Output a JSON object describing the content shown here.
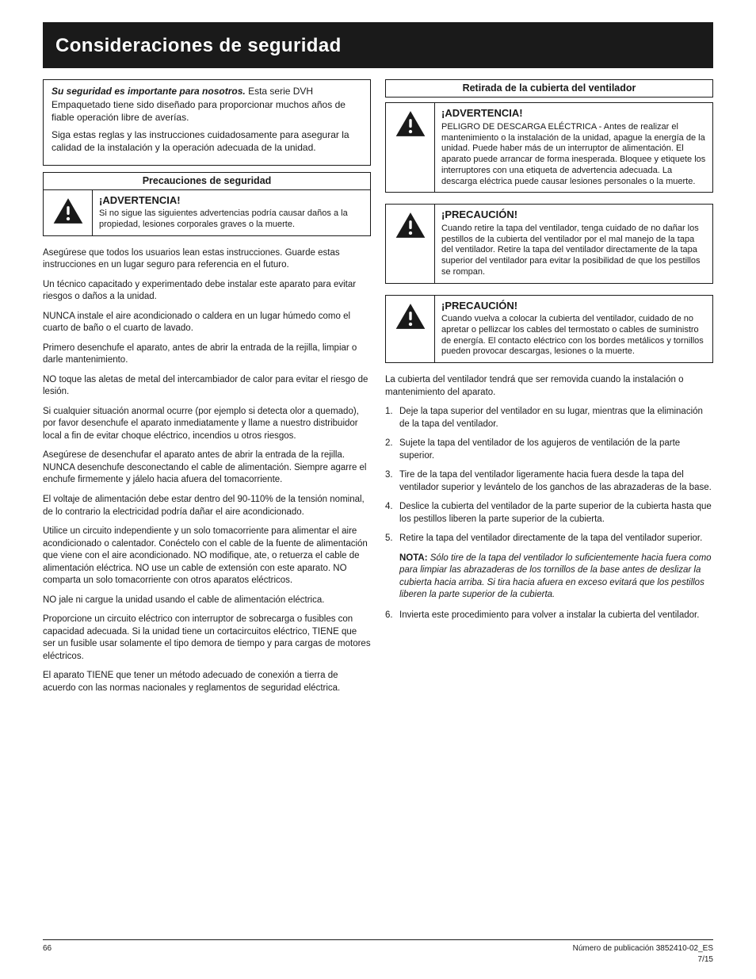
{
  "header": {
    "title": "Consideraciones de seguridad"
  },
  "left": {
    "intro": {
      "p1_prefix": "Su seguridad es importante para nosotros.",
      "p1_rest": " Esta serie DVH Empaquetado tiene sido diseñado para proporcionar muchos años de fiable operación libre de averías.",
      "p2": "Siga estas reglas y las instrucciones cuidadosamente para asegurar la calidad de la instalación y la operación adecuada de la unidad."
    },
    "section_title": "Precauciones de seguridad",
    "warn": {
      "title": "¡ADVERTENCIA!",
      "body": "Si no sigue las siguientes advertencias podría causar daños a la propiedad, lesiones corporales graves o la muerte."
    },
    "body": {
      "p1": "Asegúrese que todos los usuarios lean estas instrucciones. Guarde estas instrucciones en un lugar seguro para referencia en el futuro.",
      "p2": "Un técnico capacitado y experimentado debe instalar este aparato para evitar riesgos o daños a la unidad.",
      "p3": "NUNCA instale el aire acondicionado o caldera en un lugar húmedo como el cuarto de baño o el cuarto de lavado.",
      "p4": "Primero desenchufe el aparato, antes de abrir la entrada de la rejilla, limpiar o darle mantenimiento.",
      "p5": "NO toque las aletas de metal del intercambiador de calor para evitar el riesgo de lesión.",
      "p6": "Si cualquier situación anormal ocurre (por ejemplo si detecta olor a quemado), por favor desenchufe el aparato inmediatamente y llame a nuestro distribuidor local a fin de evitar choque eléctrico, incendios u otros riesgos.",
      "p7": "Asegúrese de desenchufar el aparato antes de abrir la entrada de la rejilla. NUNCA desenchufe desconectando el cable de alimentación. Siempre agarre el enchufe firmemente y jálelo hacia afuera del tomacorriente.",
      "p8": "El voltaje de alimentación debe estar dentro del 90-110% de la tensión nominal, de lo contrario la electricidad podría dañar el aire acondicionado.",
      "p9": "Utilice un circuito independiente y un solo tomacorriente para alimentar el aire acondicionado o calentador. Conéctelo con el cable de la fuente de alimentación que viene con el aire acondicionado. NO modifique, ate, o retuerza el cable de alimentación eléctrica. NO use un cable de extensión con este aparato. NO comparta un solo tomacorriente con otros aparatos eléctricos.",
      "p10": "NO jale ni cargue la unidad usando el cable de alimentación eléctrica.",
      "p11": "Proporcione un circuito eléctrico con interruptor de sobrecarga o fusibles con capacidad adecuada. Si la unidad tiene un cortacircuitos eléctrico, TIENE que ser un fusible usar solamente el tipo demora de tiempo y para cargas de motores eléctricos.",
      "p12": "El aparato TIENE que tener un método adecuado de conexión a tierra de acuerdo con las normas nacionales y reglamentos de seguridad eléctrica."
    }
  },
  "right": {
    "section_title": "Retirada de la cubierta del ventilador",
    "w1": {
      "title": "¡ADVERTENCIA!",
      "body": "PELIGRO DE DESCARGA ELÉCTRICA - Antes de realizar el mantenimiento o la instalación de la unidad, apague la energía de la unidad. Puede haber más de un interruptor de alimentación. El aparato puede arrancar de forma inesperada. Bloquee y etiquete los interruptores con una etiqueta de advertencia adecuada. La descarga eléctrica puede causar lesiones personales o la muerte."
    },
    "w2": {
      "title": "¡PRECAUCIÓN!",
      "body": "Cuando retire la tapa del ventilador, tenga cuidado de no dañar los pestillos de la cubierta del ventilador por el mal manejo de la tapa del ventilador. Retire la tapa del ventilador directamente de la tapa superior del ventilador para evitar la posibilidad de que los pestillos se rompan."
    },
    "w3": {
      "title": "¡PRECAUCIÓN!",
      "body": "Cuando vuelva a colocar la cubierta del ventilador, cuidado de no apretar o pellizcar los cables del termostato o cables de suministro de energía. El contacto eléctrico con los bordes metálicos y tornillos pueden provocar descargas, lesiones o la muerte."
    },
    "body": {
      "p_intro": "La cubierta del ventilador tendrá que ser removida cuando la instalación o mantenimiento del aparato.",
      "n1": {
        "num": "1.",
        "text": "Deje la tapa superior del ventilador en su lugar, mientras que la eliminación de la tapa del ventilador."
      },
      "n2": {
        "num": "2.",
        "text": "Sujete la tapa del ventilador de los agujeros de ventilación de la parte superior."
      },
      "n3": {
        "num": "3.",
        "text": "Tire de la tapa del ventilador ligeramente hacia fuera desde la tapa del ventilador superior y levántelo de los ganchos de las abrazaderas de la base."
      },
      "n4": {
        "num": "4.",
        "text": "Deslice la cubierta del ventilador de la parte superior de la cubierta hasta que los pestillos liberen la parte superior de la cubierta."
      },
      "n5": {
        "num": "5.",
        "text": "Retire la tapa del ventilador directamente de la tapa del ventilador superior."
      },
      "note_label": "NOTA:",
      "note_rest": " Sólo tire de la tapa del ventilador lo suficientemente hacia fuera como para limpiar las abrazaderas de los tornillos de la base antes de deslizar la cubierta hacia arriba. Si tira hacia afuera en exceso evitará que los pestillos liberen la parte superior de la cubierta.",
      "n6": {
        "num": "6.",
        "text": "Invierta este procedimiento para volver a instalar la cubierta del ventilador."
      }
    }
  },
  "footer": {
    "page": "66",
    "pub_label": "Número de publicación",
    "pub_num": "3852410-02_ES",
    "date": "7/15"
  }
}
